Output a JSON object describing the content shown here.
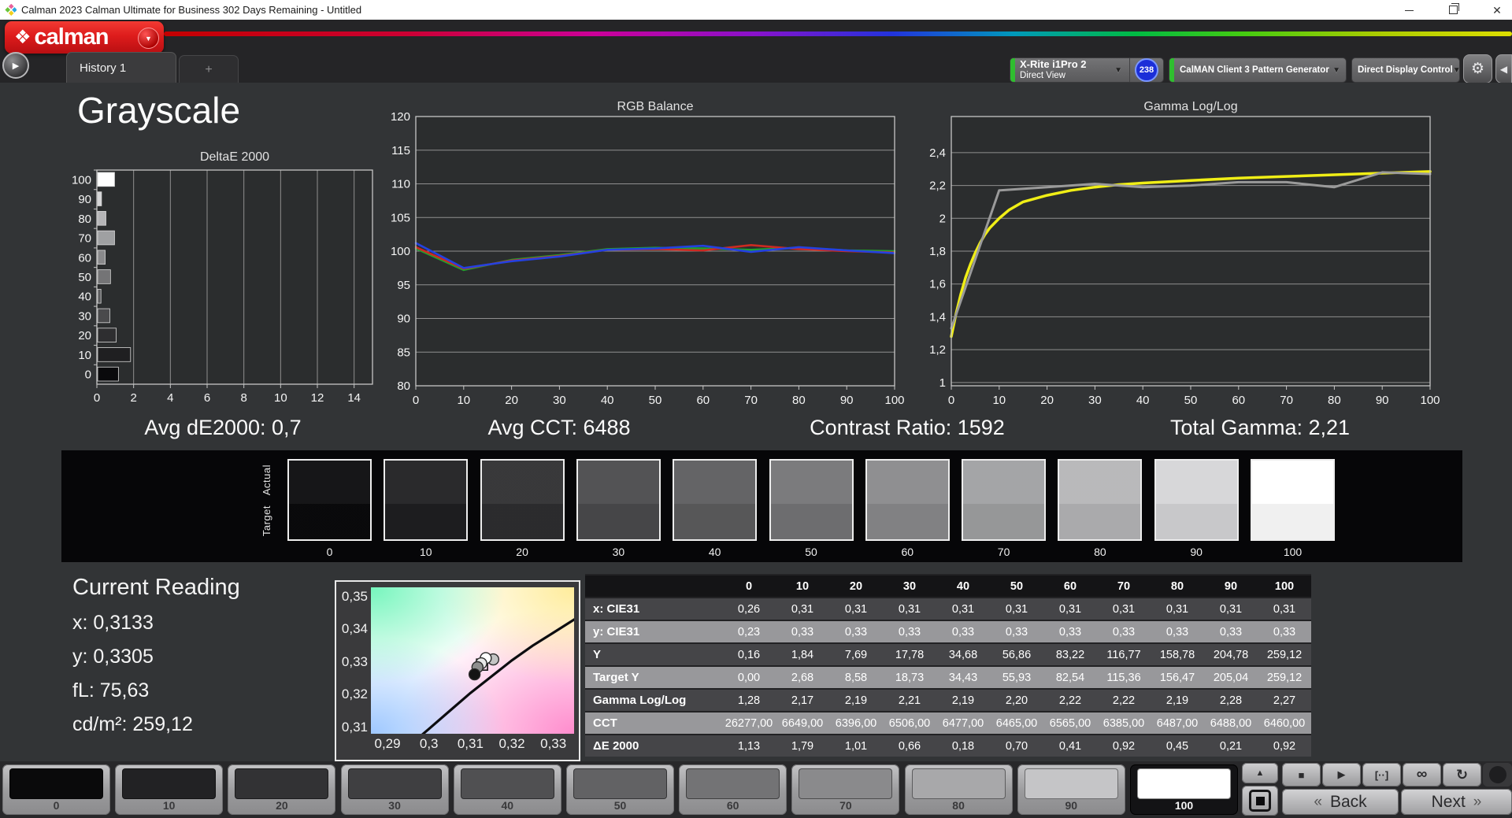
{
  "title_bar": {
    "title": "Calman 2023 Calman Ultimate for Business 302 Days Remaining  - Untitled",
    "close_glyph": "✕"
  },
  "header": {
    "logo_glyph": "❖",
    "logo_text": "calman",
    "tab_label": "History 1",
    "tab_add": "+",
    "run_glyph": "▶",
    "dropdown_arrow": "▼",
    "gear_glyph": "⚙",
    "collapse_glyph": "◀",
    "dropdowns": [
      {
        "line1": "X-Rite i1Pro 2",
        "line2": "Direct View",
        "badge": "238",
        "accent": "#2fbe2f"
      },
      {
        "line1": "CalMAN Client 3 Pattern Generator",
        "accent": "#2fbe2f"
      },
      {
        "line1": "Direct Display Control",
        "accent": "#e3d414"
      }
    ]
  },
  "page": {
    "title": "Grayscale"
  },
  "stats": [
    "Avg dE2000: 0,7",
    "Avg CCT: 6488",
    "Contrast Ratio: 1592",
    "Total Gamma: 2,21"
  ],
  "chart_data": [
    {
      "type": "bar",
      "title": "DeltaE 2000",
      "orientation": "horizontal",
      "categories": [
        "0",
        "10",
        "20",
        "30",
        "40",
        "50",
        "60",
        "70",
        "80",
        "90",
        "100"
      ],
      "values": [
        1.13,
        1.79,
        1.01,
        0.66,
        0.18,
        0.7,
        0.41,
        0.92,
        0.45,
        0.21,
        0.92
      ],
      "bar_shades": [
        "#0a0a0c",
        "#1f1f21",
        "#2e2e30",
        "#4a4a4c",
        "#5c5c5e",
        "#747476",
        "#89898b",
        "#9fa0a2",
        "#b5b5b7",
        "#d5d5d7",
        "#ffffff"
      ],
      "xlim": [
        0,
        15
      ],
      "xticks": [
        0,
        2,
        4,
        6,
        8,
        10,
        12,
        14
      ]
    },
    {
      "type": "line",
      "title": "RGB Balance",
      "x": [
        0,
        10,
        20,
        30,
        40,
        50,
        60,
        70,
        80,
        90,
        100
      ],
      "ylim": [
        80,
        120
      ],
      "yticks": [
        {
          "v": 80,
          "label": "80"
        },
        {
          "v": 85,
          "label": "85"
        },
        {
          "v": 90,
          "label": "90"
        },
        {
          "v": 95,
          "label": "95"
        },
        {
          "v": 100,
          "label": "100"
        },
        {
          "v": 105,
          "label": "105"
        },
        {
          "v": 110,
          "label": "110"
        },
        {
          "v": 115,
          "label": "115"
        },
        {
          "v": 120,
          "label": "120"
        }
      ],
      "xticks": [
        {
          "v": 0,
          "label": "0"
        },
        {
          "v": 10,
          "label": "10"
        },
        {
          "v": 20,
          "label": "20"
        },
        {
          "v": 30,
          "label": "30"
        },
        {
          "v": 40,
          "label": "40"
        },
        {
          "v": 50,
          "label": "50"
        },
        {
          "v": 60,
          "label": "60"
        },
        {
          "v": 70,
          "label": "70"
        },
        {
          "v": 80,
          "label": "80"
        },
        {
          "v": 90,
          "label": "90"
        },
        {
          "v": 100,
          "label": "100"
        }
      ],
      "series": [
        {
          "name": "Green",
          "color": "#1fa32e",
          "width": 2.6,
          "values": [
            100.4,
            97.2,
            98.7,
            99.4,
            100.3,
            100.5,
            100.4,
            100.2,
            100.5,
            100.1,
            100.0
          ]
        },
        {
          "name": "Red",
          "color": "#cc2a22",
          "width": 2.6,
          "values": [
            100.6,
            97.4,
            98.6,
            99.3,
            100.2,
            100.3,
            100.1,
            100.9,
            100.3,
            100.0,
            99.8
          ]
        },
        {
          "name": "Blue",
          "color": "#2441e0",
          "width": 2.6,
          "values": [
            101.2,
            97.5,
            98.5,
            99.2,
            100.2,
            100.4,
            100.8,
            99.9,
            100.6,
            100.1,
            99.7
          ]
        }
      ]
    },
    {
      "type": "line",
      "title": "Gamma Log/Log",
      "x": [
        0,
        10,
        20,
        30,
        40,
        50,
        60,
        70,
        80,
        90,
        100
      ],
      "ylim": [
        0.98,
        2.62
      ],
      "yticks": [
        {
          "v": 1,
          "label": "1"
        },
        {
          "v": 1.2,
          "label": "1,2"
        },
        {
          "v": 1.4,
          "label": "1,4"
        },
        {
          "v": 1.6,
          "label": "1,6"
        },
        {
          "v": 1.8,
          "label": "1,8"
        },
        {
          "v": 2,
          "label": "2"
        },
        {
          "v": 2.2,
          "label": "2,2"
        },
        {
          "v": 2.4,
          "label": "2,4"
        }
      ],
      "xticks": [
        {
          "v": 0,
          "label": "0"
        },
        {
          "v": 10,
          "label": "10"
        },
        {
          "v": 20,
          "label": "20"
        },
        {
          "v": 30,
          "label": "30"
        },
        {
          "v": 40,
          "label": "40"
        },
        {
          "v": 50,
          "label": "50"
        },
        {
          "v": 60,
          "label": "60"
        },
        {
          "v": 70,
          "label": "70"
        },
        {
          "v": 80,
          "label": "80"
        },
        {
          "v": 90,
          "label": "90"
        },
        {
          "v": 100,
          "label": "100"
        }
      ],
      "series": [
        {
          "name": "Target Gamma",
          "color": "#f0ee16",
          "width": 3.5,
          "x": [
            0,
            1,
            2,
            3,
            4,
            5,
            6,
            7,
            8,
            10,
            12,
            15,
            20,
            25,
            30,
            35,
            40,
            50,
            60,
            70,
            80,
            90,
            100
          ],
          "values": [
            1.28,
            1.42,
            1.54,
            1.64,
            1.72,
            1.79,
            1.85,
            1.9,
            1.94,
            2.0,
            2.05,
            2.1,
            2.14,
            2.17,
            2.19,
            2.205,
            2.215,
            2.23,
            2.245,
            2.255,
            2.265,
            2.275,
            2.285
          ]
        },
        {
          "name": "Measured Gamma",
          "color": "#9a9a9a",
          "width": 3,
          "values": [
            1.33,
            2.17,
            2.19,
            2.21,
            2.19,
            2.2,
            2.22,
            2.22,
            2.19,
            2.28,
            2.27
          ]
        }
      ]
    },
    {
      "type": "scatter",
      "title": "CIE xy chromaticity (white point detail)",
      "xlim": [
        0.286,
        0.335
      ],
      "ylim": [
        0.308,
        0.3529
      ],
      "xticks": [
        {
          "v": 0.29,
          "label": "0,29"
        },
        {
          "v": 0.3,
          "label": "0,3"
        },
        {
          "v": 0.31,
          "label": "0,31"
        },
        {
          "v": 0.32,
          "label": "0,32"
        },
        {
          "v": 0.33,
          "label": "0,33"
        }
      ],
      "yticks": [
        {
          "v": 0.35,
          "label": "0,35"
        },
        {
          "v": 0.34,
          "label": "0,34"
        },
        {
          "v": 0.33,
          "label": "0,33"
        },
        {
          "v": 0.32,
          "label": "0,32"
        },
        {
          "v": 0.31,
          "label": "0,31"
        }
      ],
      "locus": [
        [
          0.2945,
          0.3035
        ],
        [
          0.3,
          0.3095
        ],
        [
          0.305,
          0.315
        ],
        [
          0.31,
          0.3205
        ],
        [
          0.315,
          0.3255
        ],
        [
          0.32,
          0.3305
        ],
        [
          0.325,
          0.335
        ],
        [
          0.33,
          0.339
        ],
        [
          0.335,
          0.343
        ],
        [
          0.338,
          0.3455
        ]
      ],
      "points": [
        {
          "x": 0.3155,
          "y": 0.3308,
          "color": "#c4c4c4"
        },
        {
          "x": 0.3137,
          "y": 0.3312,
          "color": "#ffffff"
        },
        {
          "x": 0.3126,
          "y": 0.3296,
          "color": "#e8e8e8"
        },
        {
          "x": 0.3117,
          "y": 0.3284,
          "color": "#8e8e8e"
        },
        {
          "x": 0.311,
          "y": 0.3262,
          "color": "#141414"
        }
      ],
      "target_marker": {
        "x": 0.3128,
        "y": 0.3292
      }
    }
  ],
  "swatch_strip": {
    "actual_label": "Actual",
    "target_label": "Target",
    "levels": [
      "0",
      "10",
      "20",
      "30",
      "40",
      "50",
      "60",
      "70",
      "80",
      "90",
      "100"
    ],
    "shades": [
      "#0a0a0c",
      "#1f1f21",
      "#2e2e30",
      "#4a4a4c",
      "#5c5c5e",
      "#747476",
      "#89898b",
      "#9fa0a2",
      "#b5b5b7",
      "#d5d5d7",
      "#ffffff"
    ]
  },
  "current_reading": {
    "title": "Current Reading",
    "lines": [
      "x: 0,3133",
      "y: 0,3305",
      "fL: 75,63",
      "cd/m²: 259,12"
    ]
  },
  "table": {
    "columns": [
      "0",
      "10",
      "20",
      "30",
      "40",
      "50",
      "60",
      "70",
      "80",
      "90",
      "100"
    ],
    "rows": [
      {
        "label": "x: CIE31",
        "values": [
          "0,26",
          "0,31",
          "0,31",
          "0,31",
          "0,31",
          "0,31",
          "0,31",
          "0,31",
          "0,31",
          "0,31",
          "0,31"
        ]
      },
      {
        "label": "y: CIE31",
        "values": [
          "0,23",
          "0,33",
          "0,33",
          "0,33",
          "0,33",
          "0,33",
          "0,33",
          "0,33",
          "0,33",
          "0,33",
          "0,33"
        ]
      },
      {
        "label": "Y",
        "values": [
          "0,16",
          "1,84",
          "7,69",
          "17,78",
          "34,68",
          "56,86",
          "83,22",
          "116,77",
          "158,78",
          "204,78",
          "259,12"
        ]
      },
      {
        "label": "Target Y",
        "values": [
          "0,00",
          "2,68",
          "8,58",
          "18,73",
          "34,43",
          "55,93",
          "82,54",
          "115,36",
          "156,47",
          "205,04",
          "259,12"
        ]
      },
      {
        "label": "Gamma Log/Log",
        "values": [
          "1,28",
          "2,17",
          "2,19",
          "2,21",
          "2,19",
          "2,20",
          "2,22",
          "2,22",
          "2,19",
          "2,28",
          "2,27"
        ]
      },
      {
        "label": "CCT",
        "values": [
          "26277,00",
          "6649,00",
          "6396,00",
          "6506,00",
          "6477,00",
          "6465,00",
          "6565,00",
          "6385,00",
          "6487,00",
          "6488,00",
          "6460,00"
        ]
      },
      {
        "label": "ΔE 2000",
        "values": [
          "1,13",
          "1,79",
          "1,01",
          "0,66",
          "0,18",
          "0,70",
          "0,41",
          "0,92",
          "0,45",
          "0,21",
          "0,92"
        ]
      }
    ]
  },
  "bottom_bar": {
    "patterns": [
      {
        "label": "0",
        "shade": "#0a0a0b"
      },
      {
        "label": "10",
        "shade": "#222224"
      },
      {
        "label": "20",
        "shade": "#323234"
      },
      {
        "label": "30",
        "shade": "#3f3f41"
      },
      {
        "label": "40",
        "shade": "#505052"
      },
      {
        "label": "50",
        "shade": "#626264"
      },
      {
        "label": "60",
        "shade": "#737375"
      },
      {
        "label": "70",
        "shade": "#8a8a8c"
      },
      {
        "label": "80",
        "shade": "#a8a8aa"
      },
      {
        "label": "90",
        "shade": "#c5c5c7"
      },
      {
        "label": "100",
        "shade": "#ffffff"
      }
    ],
    "selected": "100",
    "up_glyph": "▲",
    "controls": [
      {
        "name": "stop",
        "glyph": "■"
      },
      {
        "name": "play",
        "glyph": "▶"
      },
      {
        "name": "pattern-window",
        "glyph": "[··]"
      },
      {
        "name": "loop",
        "glyph": "∞"
      },
      {
        "name": "refresh",
        "glyph": "↻"
      }
    ],
    "back_chevron": "«",
    "next_chevron": "»",
    "back_label": "Back",
    "next_label": "Next"
  }
}
